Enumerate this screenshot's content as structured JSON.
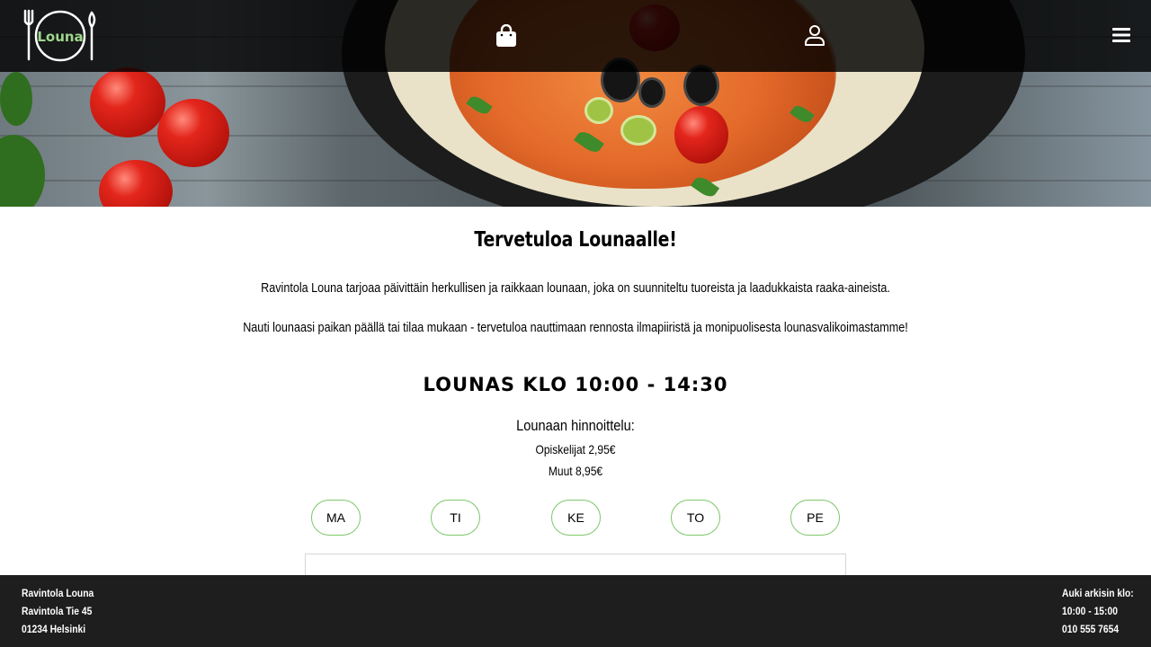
{
  "header": {
    "logo_text": "Louna",
    "icons": {
      "cart": "shopping-bag-icon",
      "account": "user-icon",
      "menu": "hamburger-menu-icon"
    }
  },
  "main": {
    "welcome_title": "Tervetuloa Lounaalle!",
    "intro_1": "Ravintola Louna tarjoaa päivittäin herkullisen ja raikkaan lounaan, joka on suunniteltu tuoreista ja laadukkaista raaka-aineista.",
    "intro_2": "Nauti lounaasi paikan päällä tai tilaa mukaan - tervetuloa nauttimaan rennosta ilmapiiristä ja monipuolisesta lounasvalikoimastamme!",
    "hours_title": "LOUNAS KLO 10:00 - 14:30",
    "pricing": {
      "title": "Lounaan hinnoittelu:",
      "students": "Opiskelijat 2,95€",
      "others": "Muut 8,95€"
    },
    "days": [
      "MA",
      "TI",
      "KE",
      "TO",
      "PE"
    ]
  },
  "footer": {
    "address": {
      "name": "Ravintola Louna",
      "street": "Ravintola Tie 45",
      "city": "01234 Helsinki"
    },
    "hours": {
      "label": "Auki arkisin klo:",
      "time": "10:00 - 15:00",
      "phone": "010 555 7654"
    }
  },
  "colors": {
    "accent": "#7dc66a",
    "header_bg": "#000000",
    "footer_bg": "#1e1e1e",
    "logo_text": "#9ed68a"
  }
}
